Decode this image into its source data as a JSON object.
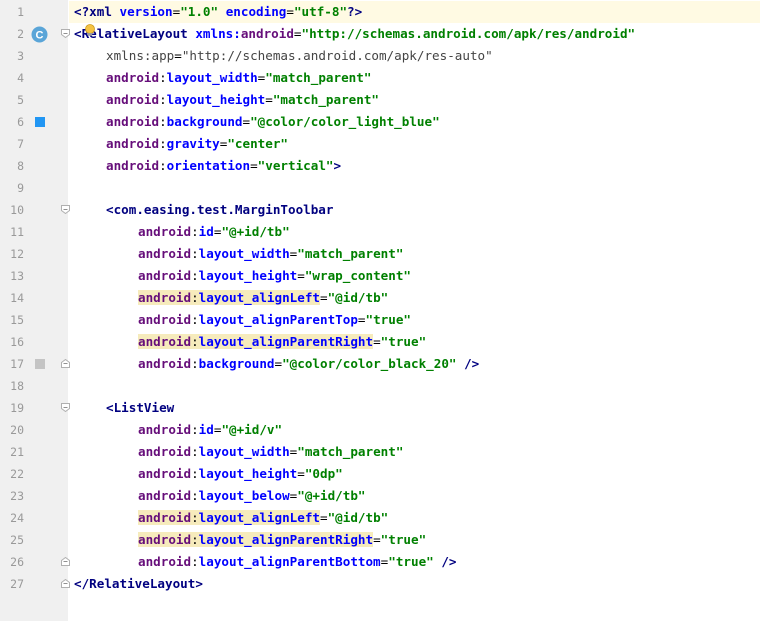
{
  "editor": {
    "colors": {
      "gutter_bg": "#f0f0f0",
      "line_number": "#999999",
      "current_line_bg": "#fffae3",
      "tag": "#000080",
      "namespace": "#660e7a",
      "attribute": "#0000ff",
      "value": "#008000",
      "warning_highlight": "#f6ebbc",
      "color_swatch_light_blue": "#2196f3",
      "color_swatch_black_20": "#c4c4c4",
      "class_badge": "#5aa5d8"
    },
    "current_line": 1,
    "lines": [
      {
        "n": "1",
        "indent": 0,
        "tokens": [
          {
            "t": "<?",
            "c": "t-pi"
          },
          {
            "t": "xml",
            "c": "t-pi"
          },
          {
            "t": " "
          },
          {
            "t": "version",
            "c": "t-attr"
          },
          {
            "t": "="
          },
          {
            "t": "\"1.0\"",
            "c": "t-val"
          },
          {
            "t": " "
          },
          {
            "t": "encoding",
            "c": "t-attr"
          },
          {
            "t": "="
          },
          {
            "t": "\"utf-8\"",
            "c": "t-val"
          },
          {
            "t": "?>",
            "c": "t-pi"
          }
        ]
      },
      {
        "n": "2",
        "indent": 0,
        "gutter_icon": "class-icon",
        "fold": "open",
        "tokens": [
          {
            "t": "<",
            "c": "t-tag"
          },
          {
            "t": "RelativeLayout",
            "c": "t-tag"
          },
          {
            "t": " "
          },
          {
            "t": "xmlns:",
            "c": "t-attr"
          },
          {
            "t": "android",
            "c": "t-ns"
          },
          {
            "t": "="
          },
          {
            "t": "\"http://schemas.android.com/apk/res/android\"",
            "c": "t-val"
          }
        ]
      },
      {
        "n": "3",
        "indent": 1,
        "tokens": [
          {
            "t": "xmlns:",
            "c": "t-attrplain"
          },
          {
            "t": "app",
            "c": "t-attrplain"
          },
          {
            "t": "="
          },
          {
            "t": "\"http://schemas.android.com/apk/res-auto\"",
            "c": "t-valplain"
          }
        ]
      },
      {
        "n": "4",
        "indent": 1,
        "tokens": [
          {
            "t": "android",
            "c": "t-ns"
          },
          {
            "t": ":"
          },
          {
            "t": "layout_width",
            "c": "t-attr"
          },
          {
            "t": "="
          },
          {
            "t": "\"match_parent\"",
            "c": "t-val"
          }
        ]
      },
      {
        "n": "5",
        "indent": 1,
        "tokens": [
          {
            "t": "android",
            "c": "t-ns"
          },
          {
            "t": ":"
          },
          {
            "t": "layout_height",
            "c": "t-attr"
          },
          {
            "t": "="
          },
          {
            "t": "\"match_parent\"",
            "c": "t-val"
          }
        ]
      },
      {
        "n": "6",
        "indent": 1,
        "gutter_icon": "color-swatch-light-blue",
        "tokens": [
          {
            "t": "android",
            "c": "t-ns"
          },
          {
            "t": ":"
          },
          {
            "t": "background",
            "c": "t-attr"
          },
          {
            "t": "="
          },
          {
            "t": "\"@color/color_light_blue\"",
            "c": "t-val"
          }
        ]
      },
      {
        "n": "7",
        "indent": 1,
        "tokens": [
          {
            "t": "android",
            "c": "t-ns"
          },
          {
            "t": ":"
          },
          {
            "t": "gravity",
            "c": "t-attr"
          },
          {
            "t": "="
          },
          {
            "t": "\"center\"",
            "c": "t-val"
          }
        ]
      },
      {
        "n": "8",
        "indent": 1,
        "tokens": [
          {
            "t": "android",
            "c": "t-ns"
          },
          {
            "t": ":"
          },
          {
            "t": "orientation",
            "c": "t-attr"
          },
          {
            "t": "="
          },
          {
            "t": "\"vertical\"",
            "c": "t-val"
          },
          {
            "t": ">",
            "c": "t-tag"
          }
        ]
      },
      {
        "n": "9",
        "indent": 0,
        "tokens": []
      },
      {
        "n": "10",
        "indent": 1,
        "fold": "open",
        "tokens": [
          {
            "t": "<",
            "c": "t-tag"
          },
          {
            "t": "com.easing.test.MarginToolbar",
            "c": "t-tag"
          }
        ]
      },
      {
        "n": "11",
        "indent": 2,
        "tokens": [
          {
            "t": "android",
            "c": "t-ns"
          },
          {
            "t": ":"
          },
          {
            "t": "id",
            "c": "t-attr"
          },
          {
            "t": "="
          },
          {
            "t": "\"@+id/tb\"",
            "c": "t-val"
          }
        ]
      },
      {
        "n": "12",
        "indent": 2,
        "tokens": [
          {
            "t": "android",
            "c": "t-ns"
          },
          {
            "t": ":"
          },
          {
            "t": "layout_width",
            "c": "t-attr"
          },
          {
            "t": "="
          },
          {
            "t": "\"match_parent\"",
            "c": "t-val"
          }
        ]
      },
      {
        "n": "13",
        "indent": 2,
        "tokens": [
          {
            "t": "android",
            "c": "t-ns"
          },
          {
            "t": ":"
          },
          {
            "t": "layout_height",
            "c": "t-attr"
          },
          {
            "t": "="
          },
          {
            "t": "\"wrap_content\"",
            "c": "t-val"
          }
        ]
      },
      {
        "n": "14",
        "indent": 2,
        "highlight": true,
        "tokens": [
          {
            "t": "android",
            "c": "t-ns"
          },
          {
            "t": ":"
          },
          {
            "t": "layout_alignLeft",
            "c": "t-attr"
          },
          {
            "t": "="
          },
          {
            "t": "\"@id/tb\"",
            "c": "t-val"
          }
        ]
      },
      {
        "n": "15",
        "indent": 2,
        "tokens": [
          {
            "t": "android",
            "c": "t-ns"
          },
          {
            "t": ":"
          },
          {
            "t": "layout_alignParentTop",
            "c": "t-attr"
          },
          {
            "t": "="
          },
          {
            "t": "\"true\"",
            "c": "t-val"
          }
        ]
      },
      {
        "n": "16",
        "indent": 2,
        "highlight": true,
        "tokens": [
          {
            "t": "android",
            "c": "t-ns"
          },
          {
            "t": ":"
          },
          {
            "t": "layout_alignParentRight",
            "c": "t-attr"
          },
          {
            "t": "="
          },
          {
            "t": "\"true\"",
            "c": "t-val"
          }
        ]
      },
      {
        "n": "17",
        "indent": 2,
        "gutter_icon": "color-swatch-black-20",
        "fold": "close",
        "tokens": [
          {
            "t": "android",
            "c": "t-ns"
          },
          {
            "t": ":"
          },
          {
            "t": "background",
            "c": "t-attr"
          },
          {
            "t": "="
          },
          {
            "t": "\"@color/color_black_20\"",
            "c": "t-val"
          },
          {
            "t": " "
          },
          {
            "t": "/>",
            "c": "t-tag"
          }
        ]
      },
      {
        "n": "18",
        "indent": 0,
        "tokens": []
      },
      {
        "n": "19",
        "indent": 1,
        "fold": "open",
        "tokens": [
          {
            "t": "<",
            "c": "t-tag"
          },
          {
            "t": "ListView",
            "c": "t-tag"
          }
        ]
      },
      {
        "n": "20",
        "indent": 2,
        "tokens": [
          {
            "t": "android",
            "c": "t-ns"
          },
          {
            "t": ":"
          },
          {
            "t": "id",
            "c": "t-attr"
          },
          {
            "t": "="
          },
          {
            "t": "\"@+id/v\"",
            "c": "t-val"
          }
        ]
      },
      {
        "n": "21",
        "indent": 2,
        "tokens": [
          {
            "t": "android",
            "c": "t-ns"
          },
          {
            "t": ":"
          },
          {
            "t": "layout_width",
            "c": "t-attr"
          },
          {
            "t": "="
          },
          {
            "t": "\"match_parent\"",
            "c": "t-val"
          }
        ]
      },
      {
        "n": "22",
        "indent": 2,
        "tokens": [
          {
            "t": "android",
            "c": "t-ns"
          },
          {
            "t": ":"
          },
          {
            "t": "layout_height",
            "c": "t-attr"
          },
          {
            "t": "="
          },
          {
            "t": "\"0dp\"",
            "c": "t-val"
          }
        ]
      },
      {
        "n": "23",
        "indent": 2,
        "tokens": [
          {
            "t": "android",
            "c": "t-ns"
          },
          {
            "t": ":"
          },
          {
            "t": "layout_below",
            "c": "t-attr"
          },
          {
            "t": "="
          },
          {
            "t": "\"@+id/tb\"",
            "c": "t-val"
          }
        ]
      },
      {
        "n": "24",
        "indent": 2,
        "highlight": true,
        "tokens": [
          {
            "t": "android",
            "c": "t-ns"
          },
          {
            "t": ":"
          },
          {
            "t": "layout_alignLeft",
            "c": "t-attr"
          },
          {
            "t": "="
          },
          {
            "t": "\"@id/tb\"",
            "c": "t-val"
          }
        ]
      },
      {
        "n": "25",
        "indent": 2,
        "highlight": true,
        "tokens": [
          {
            "t": "android",
            "c": "t-ns"
          },
          {
            "t": ":"
          },
          {
            "t": "layout_alignParentRight",
            "c": "t-attr"
          },
          {
            "t": "="
          },
          {
            "t": "\"true\"",
            "c": "t-val"
          }
        ]
      },
      {
        "n": "26",
        "indent": 2,
        "fold": "close",
        "tokens": [
          {
            "t": "android",
            "c": "t-ns"
          },
          {
            "t": ":"
          },
          {
            "t": "layout_alignParentBottom",
            "c": "t-attr"
          },
          {
            "t": "="
          },
          {
            "t": "\"true\"",
            "c": "t-val"
          },
          {
            "t": " "
          },
          {
            "t": "/>",
            "c": "t-tag"
          }
        ]
      },
      {
        "n": "27",
        "indent": 0,
        "fold": "close",
        "tokens": [
          {
            "t": "</",
            "c": "t-tag"
          },
          {
            "t": "RelativeLayout",
            "c": "t-tag"
          },
          {
            "t": ">",
            "c": "t-tag"
          }
        ]
      }
    ]
  }
}
